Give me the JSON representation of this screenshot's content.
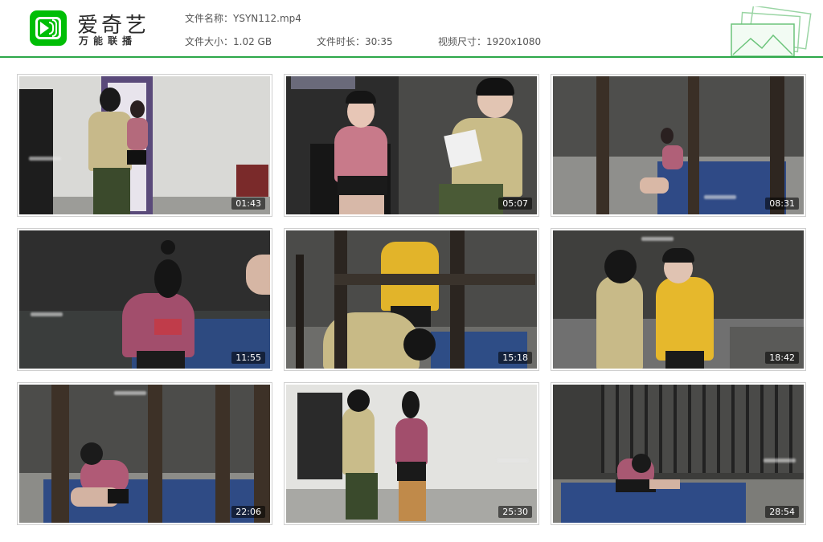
{
  "app": {
    "brand_name": "爱奇艺",
    "brand_subtitle": "万能联播",
    "accent_color": "#00be06"
  },
  "file_info": {
    "name_label": "文件名称：",
    "name_value": "YSYN112.mp4",
    "size_label": "文件大小：",
    "size_value": "1.02 GB",
    "duration_label": "文件时长：",
    "duration_value": "30:35",
    "resolution_label": "视频尺寸：",
    "resolution_value": "1920x1080"
  },
  "thumbnails": [
    {
      "timestamp": "01:43"
    },
    {
      "timestamp": "05:07"
    },
    {
      "timestamp": "08:31"
    },
    {
      "timestamp": "11:55"
    },
    {
      "timestamp": "15:18"
    },
    {
      "timestamp": "18:42"
    },
    {
      "timestamp": "22:06"
    },
    {
      "timestamp": "25:30"
    },
    {
      "timestamp": "28:54"
    }
  ]
}
